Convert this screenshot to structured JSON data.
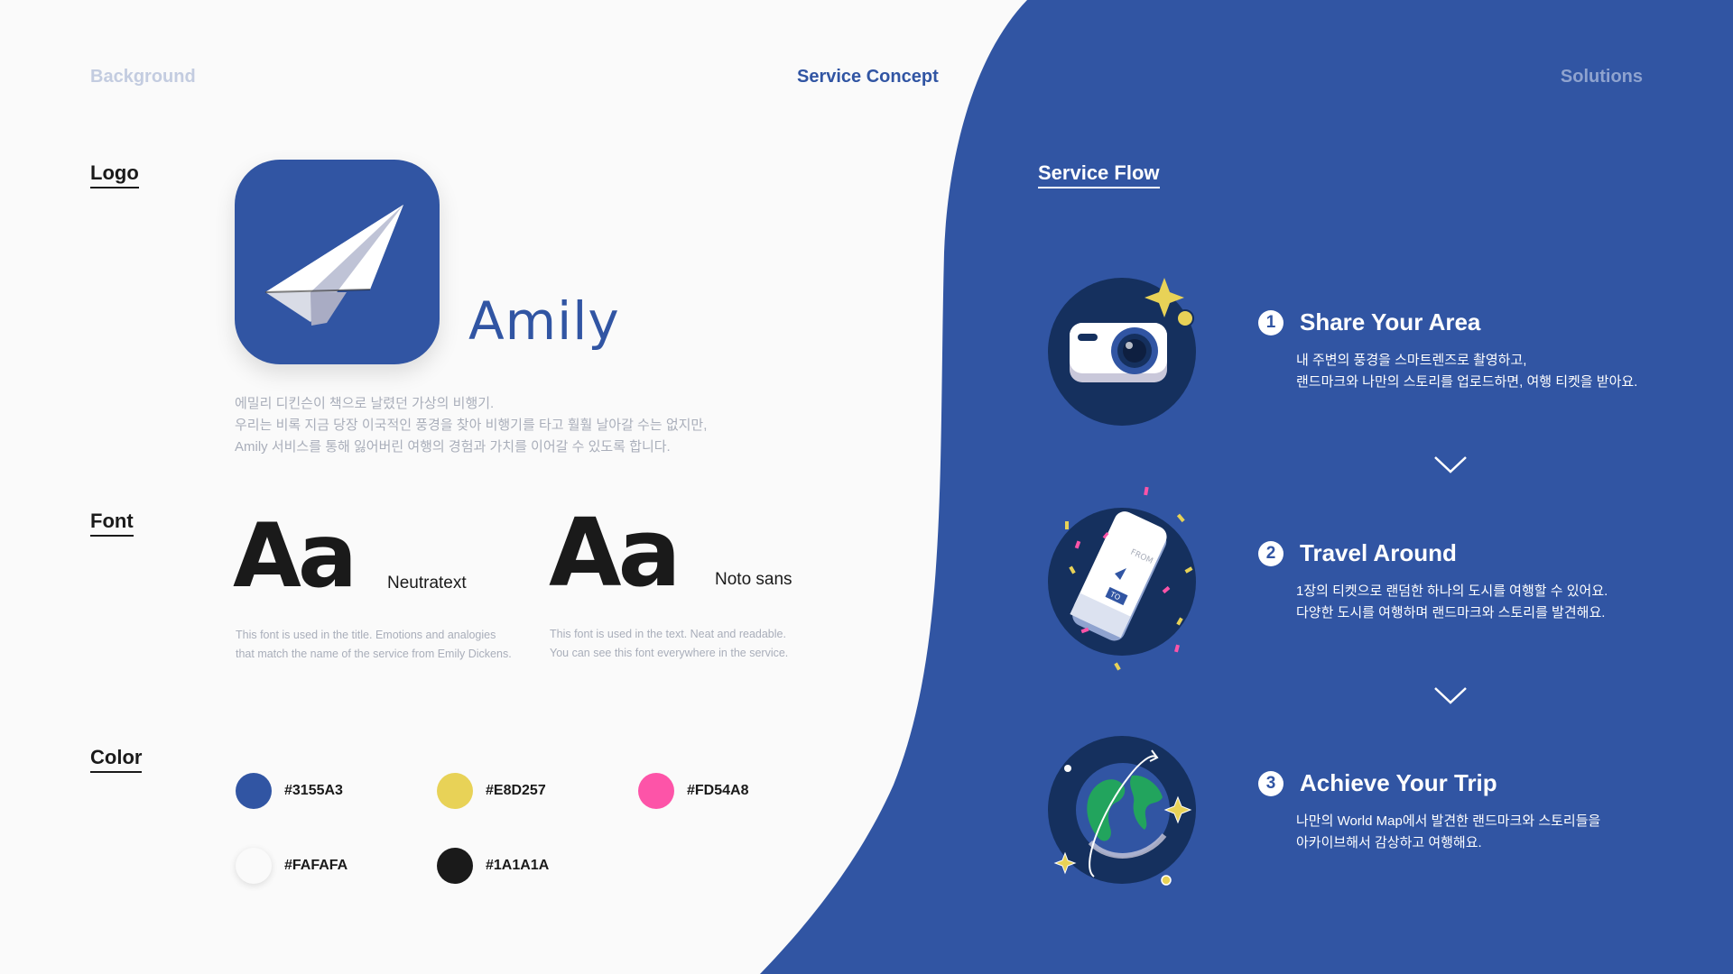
{
  "nav": {
    "left": "Background",
    "center": "Service Concept",
    "right": "Solutions"
  },
  "sections": {
    "logo": "Logo",
    "font": "Font",
    "color": "Color",
    "flow": "Service Flow"
  },
  "logo": {
    "wordmark": "Amily",
    "description": [
      "에밀리 디킨슨이 책으로 날렸던 가상의 비행기.",
      "우리는 비록 지금 당장 이국적인 풍경을 찾아 비행기를 타고 훨훨 날아갈 수는 없지만,",
      "Amily 서비스를 통해 잃어버린 여행의 경험과 가치를 이어갈 수 있도록 합니다."
    ]
  },
  "fonts": [
    {
      "sample": "Aa",
      "name": "Neutratext",
      "note": [
        "This font is used in the title. Emotions and analogies",
        "that match the name of the service from Emily Dickens."
      ]
    },
    {
      "sample": "Aa",
      "name": "Noto sans",
      "note": [
        "This font is used in the text. Neat and readable.",
        "You can see this font everywhere in the service."
      ]
    }
  ],
  "colors": [
    {
      "hex": "#3155A3",
      "value": "#3155A3"
    },
    {
      "hex": "#E8D257",
      "value": "#E8D257"
    },
    {
      "hex": "#FD54A8",
      "value": "#FD54A8"
    },
    {
      "hex": "#FAFAFA",
      "value": "#FAFAFA"
    },
    {
      "hex": "#1A1A1A",
      "value": "#1A1A1A"
    }
  ],
  "flow": [
    {
      "num": "1",
      "icon": "camera-icon",
      "title": "Share Your Area",
      "text": [
        "내 주변의 풍경을 스마트렌즈로 촬영하고,",
        "랜드마크와 나만의 스토리를 업로드하면, 여행 티켓을 받아요."
      ]
    },
    {
      "num": "2",
      "icon": "ticket-icon",
      "title": "Travel Around",
      "text": [
        "1장의 티켓으로 랜덤한 하나의 도시를 여행할 수 있어요.",
        "다양한 도시를 여행하며 랜드마크와 스토리를 발견해요."
      ]
    },
    {
      "num": "3",
      "icon": "globe-icon",
      "title": "Achieve Your Trip",
      "text": [
        "나만의 World Map에서 발견한 랜드마크와 스토리들을",
        "아카이브해서 감상하고 여행해요."
      ]
    }
  ],
  "ticket": {
    "from": "FROM",
    "to": "TO"
  },
  "theme": {
    "primary": "#3155A3",
    "dark_circle": "#15305E",
    "accent_yellow": "#E8D257",
    "accent_pink": "#FD54A8"
  }
}
